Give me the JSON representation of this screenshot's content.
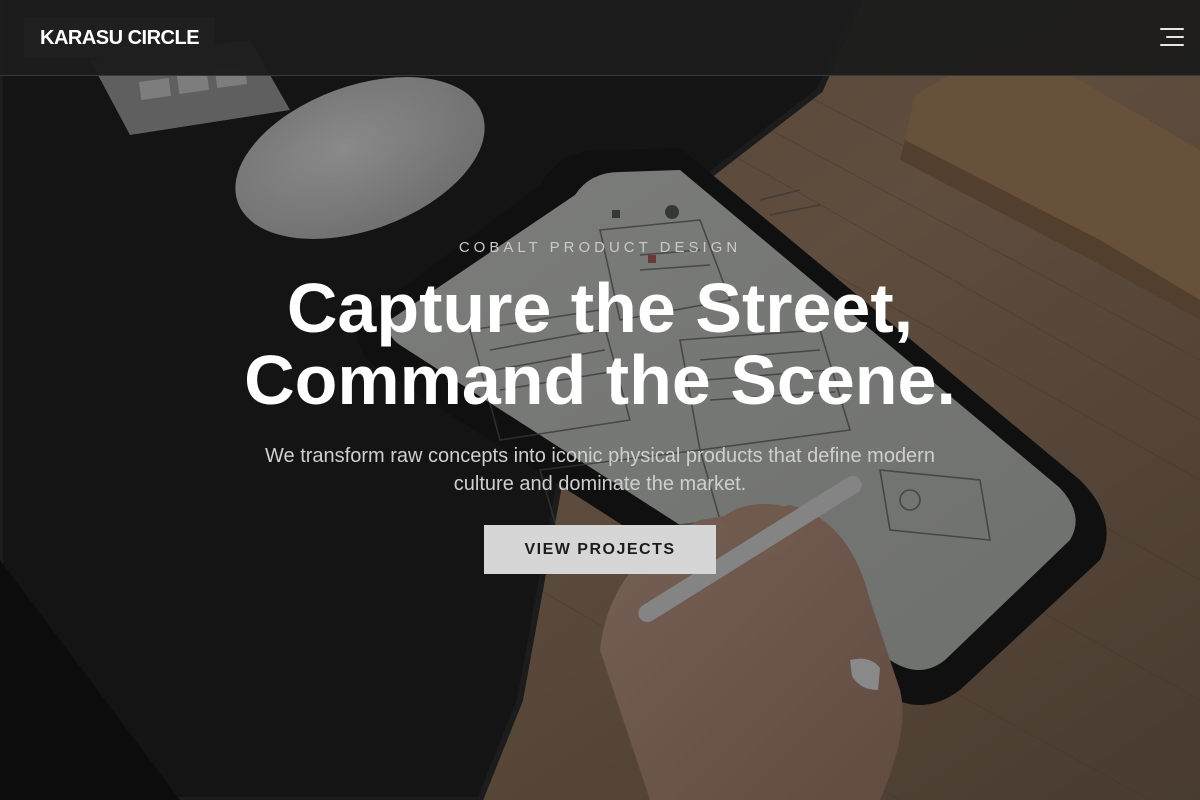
{
  "header": {
    "logo_text": "KARASU CIRCLE",
    "menu_icon": "hamburger-menu-icon"
  },
  "hero": {
    "eyebrow": "COBALT PRODUCT DESIGN",
    "headline_line1": "Capture the Street,",
    "headline_line2": "Command the Scene.",
    "subtext": "We transform raw concepts into iconic physical products that define modern culture and dominate the market.",
    "cta_label": "VIEW PROJECTS"
  },
  "colors": {
    "header_bg": "#1c1c1c",
    "cta_bg": "#d6d6d6",
    "text_primary": "#ffffff",
    "text_secondary": "#cfcfcf"
  }
}
